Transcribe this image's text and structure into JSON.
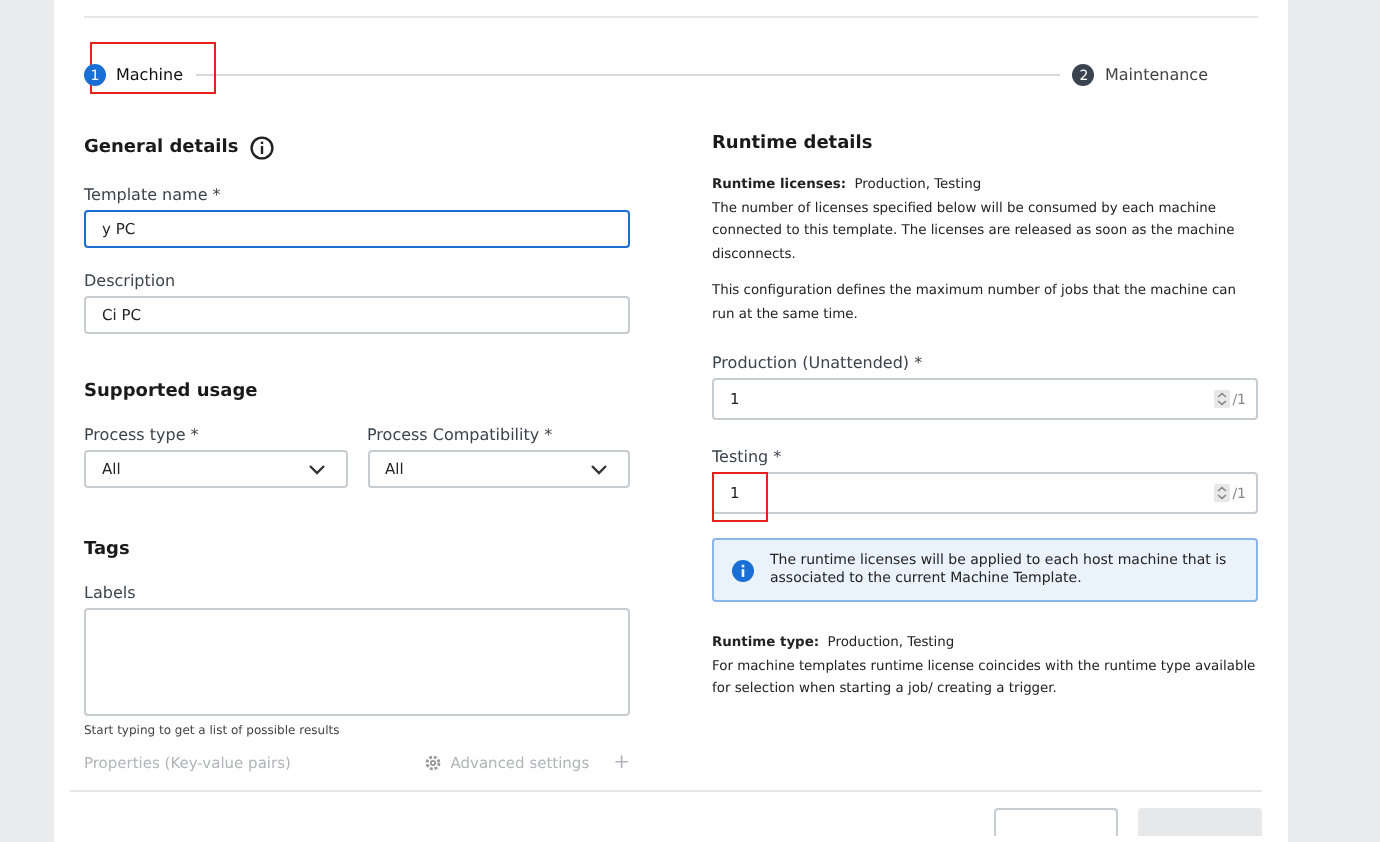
{
  "stepper": [
    {
      "number": "1",
      "label": "Machine",
      "selected": true,
      "annotated": true
    },
    {
      "number": "2",
      "label": "Maintenance",
      "selected": false,
      "annotated": false
    }
  ],
  "general": {
    "title": "General details",
    "fields": [
      {
        "label": "Template name *",
        "value": "y PC",
        "focused": true
      },
      {
        "label": "Description",
        "value": "Ci PC",
        "focused": false
      }
    ]
  },
  "usage": {
    "title": "Supported usage",
    "selects": [
      {
        "label": "Process type *",
        "value": "All"
      },
      {
        "label": "Process Compatibility *",
        "value": "All"
      }
    ]
  },
  "tags": {
    "title": "Tags",
    "label": "Labels",
    "hint": "Start typing to get a list of possible results"
  },
  "properties": {
    "label": "Properties (Key-value pairs)",
    "advanced": "Advanced settings",
    "add": "+"
  },
  "runtime": {
    "title": "Runtime details",
    "licenses_label": "Runtime licenses:",
    "licenses_value": "Production, Testing",
    "paragraphs": [
      "The number of licenses specified below will be consumed by each machine connected to this template. The licenses are released as soon as the machine disconnects.",
      "This configuration defines the maximum number of jobs that the machine can run at the same time."
    ],
    "counts": [
      {
        "label": "Production (Unattended) *",
        "value": "1",
        "max": "/1",
        "annotated": false
      },
      {
        "label": "Testing *",
        "value": "1",
        "max": "/1",
        "annotated": true
      }
    ],
    "info": "The runtime licenses will be applied to each host machine that is associated to the current Machine Template.",
    "type_label": "Runtime type:",
    "type_value": "Production, Testing",
    "type_note": "For machine templates runtime license coincides with the runtime type available for selection when starting a job/ creating a trigger."
  },
  "footer": {
    "buttons": [
      {
        "kind": "secondary"
      },
      {
        "kind": "primary"
      }
    ]
  }
}
